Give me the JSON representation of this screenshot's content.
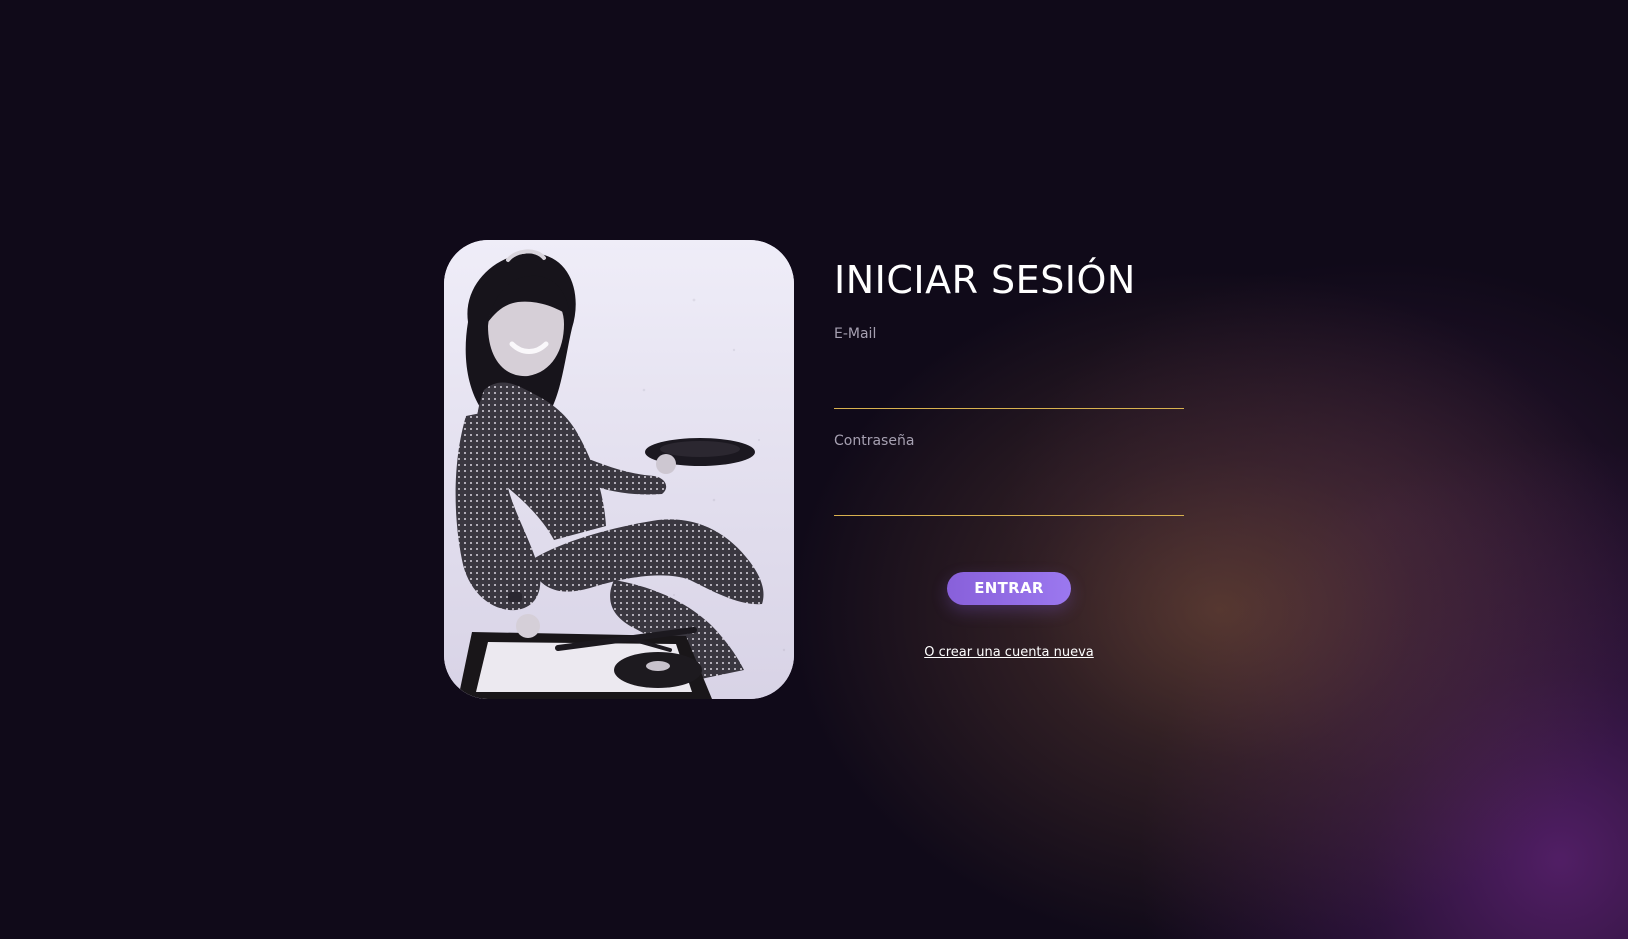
{
  "login": {
    "title": "INICIAR SESIÓN",
    "email": {
      "label": "E-Mail",
      "value": "",
      "placeholder": ""
    },
    "password": {
      "label": "Contraseña",
      "value": "",
      "placeholder": ""
    },
    "submit_label": "ENTRAR",
    "create_account_label": "O crear una cuenta nueva"
  },
  "colors": {
    "background": "#100a19",
    "accent": "#9b78ef",
    "input_underline": "#d8b14f",
    "label": "#a6a0b1",
    "text": "#ffffff"
  },
  "icons": {
    "photo": "woman-with-record-player-photo"
  }
}
